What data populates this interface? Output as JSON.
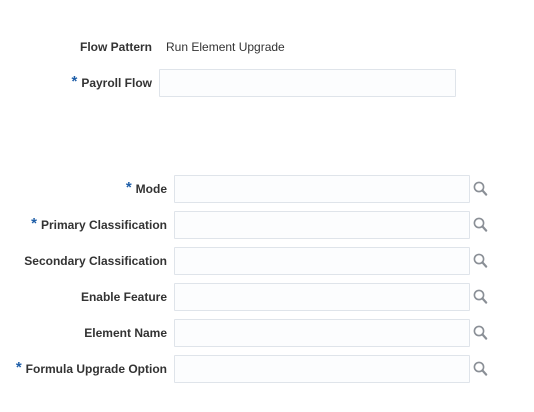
{
  "flow_pattern": {
    "label": "Flow Pattern",
    "value": "Run Element Upgrade"
  },
  "payroll_flow": {
    "label": "Payroll Flow",
    "required_marker": "*",
    "value": ""
  },
  "params": {
    "mode": {
      "label": "Mode",
      "required_marker": "*",
      "value": ""
    },
    "primary_classification": {
      "label": "Primary Classification",
      "required_marker": "*",
      "value": ""
    },
    "secondary_classification": {
      "label": "Secondary Classification",
      "value": ""
    },
    "enable_feature": {
      "label": "Enable Feature",
      "value": ""
    },
    "element_name": {
      "label": "Element Name",
      "value": ""
    },
    "formula_upgrade_option": {
      "label": "Formula Upgrade Option",
      "required_marker": "*",
      "value": ""
    }
  },
  "icons": {
    "lookup": "search-icon"
  },
  "colors": {
    "required_marker": "#1e5ea8",
    "label_text": "#333333",
    "input_border": "#dfe4ea",
    "icon": "#8a8f96"
  }
}
